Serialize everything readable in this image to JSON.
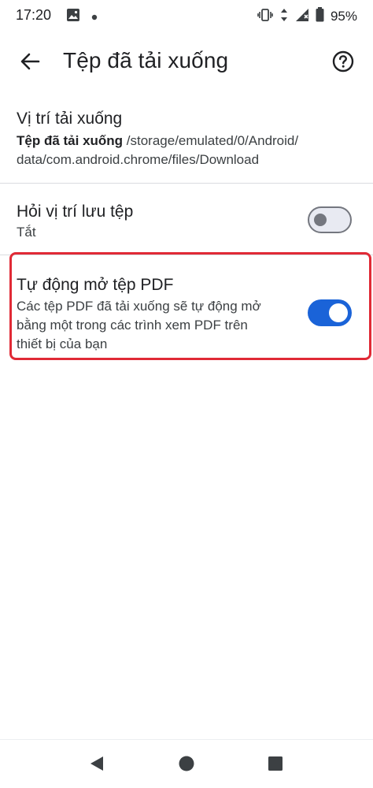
{
  "status_bar": {
    "time": "17:20",
    "battery": "95%",
    "left_icons": [
      "image-icon",
      "dot-icon"
    ],
    "right_icons": [
      "vibrate-icon",
      "data-arrows-icon",
      "signal-icon",
      "battery-icon"
    ]
  },
  "app_bar": {
    "title": "Tệp đã tải xuống",
    "back_icon": "arrow-back-icon",
    "help_icon": "help-circle-icon"
  },
  "preferences": {
    "location": {
      "title": "Vị trí tải xuống",
      "summary_bold": "Tệp đã tải xuống",
      "summary_path_line1": " /storage/emulated/0/Android/",
      "summary_path_line2": "data/com.android.chrome/files/Download"
    },
    "ask_location": {
      "title": "Hỏi vị trí lưu tệp",
      "summary": "Tắt",
      "enabled": false
    },
    "auto_open_pdf": {
      "title": "Tự động mở tệp PDF",
      "summary_line1": "Các tệp PDF đã tải xuống sẽ tự động mở",
      "summary_line2": "bằng một trong các trình xem PDF trên",
      "summary_line3": "thiết bị của bạn",
      "enabled": true
    }
  },
  "colors": {
    "accent": "#1a63d8",
    "highlight": "#e02a36",
    "divider": "#dadce0"
  },
  "nav_bar": {
    "items": [
      "back-triangle-icon",
      "home-circle-icon",
      "recents-square-icon"
    ]
  }
}
